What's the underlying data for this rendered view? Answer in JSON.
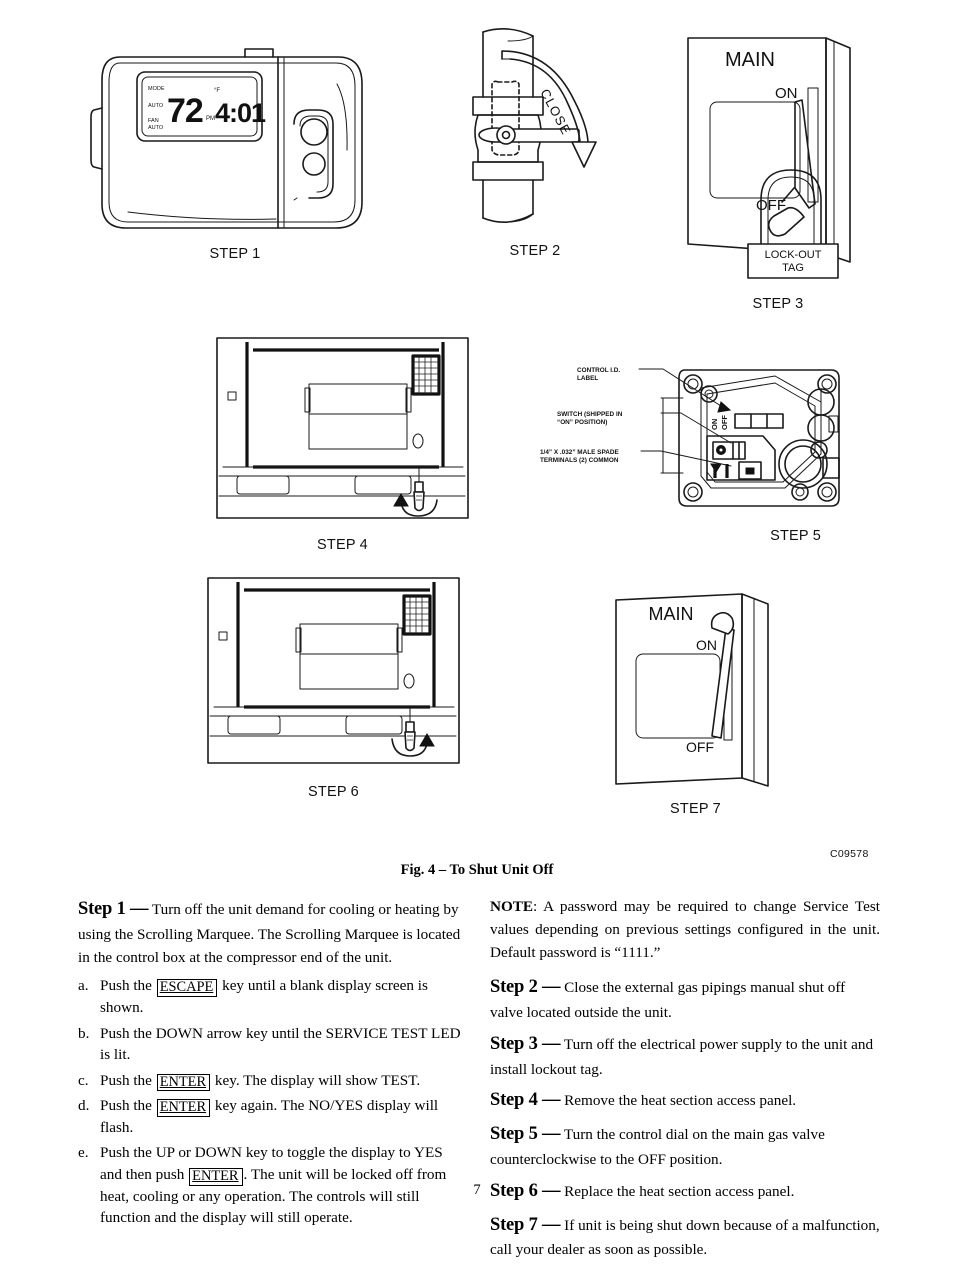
{
  "figure": {
    "caption": "Fig. 4 – To Shut Unit Off",
    "drawing_code": "C09578",
    "steps": [
      {
        "id": "step1",
        "label": "STEP 1"
      },
      {
        "id": "step2",
        "label": "STEP 2"
      },
      {
        "id": "step3",
        "label": "STEP 3"
      },
      {
        "id": "step4",
        "label": "STEP 4"
      },
      {
        "id": "step5",
        "label": "STEP 5"
      },
      {
        "id": "step6",
        "label": "STEP 6"
      },
      {
        "id": "step7",
        "label": "STEP 7"
      }
    ],
    "thermostat": {
      "temperature": "72",
      "degree_symbol": "°",
      "time": "4:01",
      "pm_indicator": "PM",
      "label_mode": "MODE",
      "label_auto": "AUTO",
      "label_fan": "FAN",
      "label_fan_auto": "AUTO"
    },
    "gas_valve_step2": {
      "rotation_label": "CLOSE"
    },
    "disconnect_step3": {
      "title": "MAIN",
      "on_label": "ON",
      "off_label": "OFF",
      "tag_line1": "LOCK-OUT",
      "tag_line2": "TAG"
    },
    "disconnect_step7": {
      "title": "MAIN",
      "on_label": "ON",
      "off_label": "OFF"
    },
    "gas_valve_step5": {
      "callout_1_line1": "CONTROL I.D.",
      "callout_1_line2": "LABEL",
      "callout_2_line1": "SWITCH (SHIPPED IN",
      "callout_2_line2": "“ON” POSITION)",
      "callout_3_line1": "1/4” X .032” MALE SPADE",
      "callout_3_line2": "TERMINALS (2) COMMON",
      "switch_on_label": "ON",
      "switch_off_label": "OFF"
    }
  },
  "body": {
    "left_column": {
      "step1_lead": "Step 1 —",
      "step1_text": " Turn off the unit demand for cooling or heating by using the Scrolling Marquee. The Scrolling Marquee is located in the control box at the compressor end of the unit.",
      "items": [
        {
          "marker": "a.",
          "pre": "Push the ",
          "key": "ESCAPE",
          "post": " key until a blank display screen is shown."
        },
        {
          "marker": "b.",
          "pre": "Push the DOWN arrow key until the SERVICE TEST LED is lit.",
          "key": "",
          "post": ""
        },
        {
          "marker": "c.",
          "pre": "Push the ",
          "key": "ENTER",
          "post": " key. The display will show TEST."
        },
        {
          "marker": "d.",
          "pre": "Push the ",
          "key": "ENTER",
          "post": " key again. The NO/YES display will flash."
        },
        {
          "marker": "e.",
          "pre": "Push the UP or DOWN key to toggle the display to YES and then push ",
          "key": "ENTER",
          "post": ". The unit will be locked off from heat, cooling or any operation. The controls will still function and the display will still operate."
        }
      ]
    },
    "right_column": {
      "note_lead": "NOTE",
      "note_text": ":  A password may be required to change Service Test values depending on previous settings configured in the unit. Default password is “1111.”",
      "steps": [
        {
          "lead": "Step 2 —",
          "text": " Close the external gas pipings manual shut off valve located outside the unit."
        },
        {
          "lead": "Step 3 —",
          "text": " Turn off the electrical power supply to the unit and install lockout tag."
        },
        {
          "lead": "Step 4 —",
          "text": " Remove the heat section access panel."
        },
        {
          "lead": "Step 5 —",
          "text": " Turn the control dial on the main gas valve counterclockwise to the OFF position."
        },
        {
          "lead": "Step 6 —",
          "text": " Replace the heat section access panel."
        },
        {
          "lead": "Step 7 —",
          "text": " If unit is being shut down because of a malfunction, call your dealer as soon as possible."
        }
      ]
    }
  },
  "footer": {
    "page_number": "7"
  }
}
